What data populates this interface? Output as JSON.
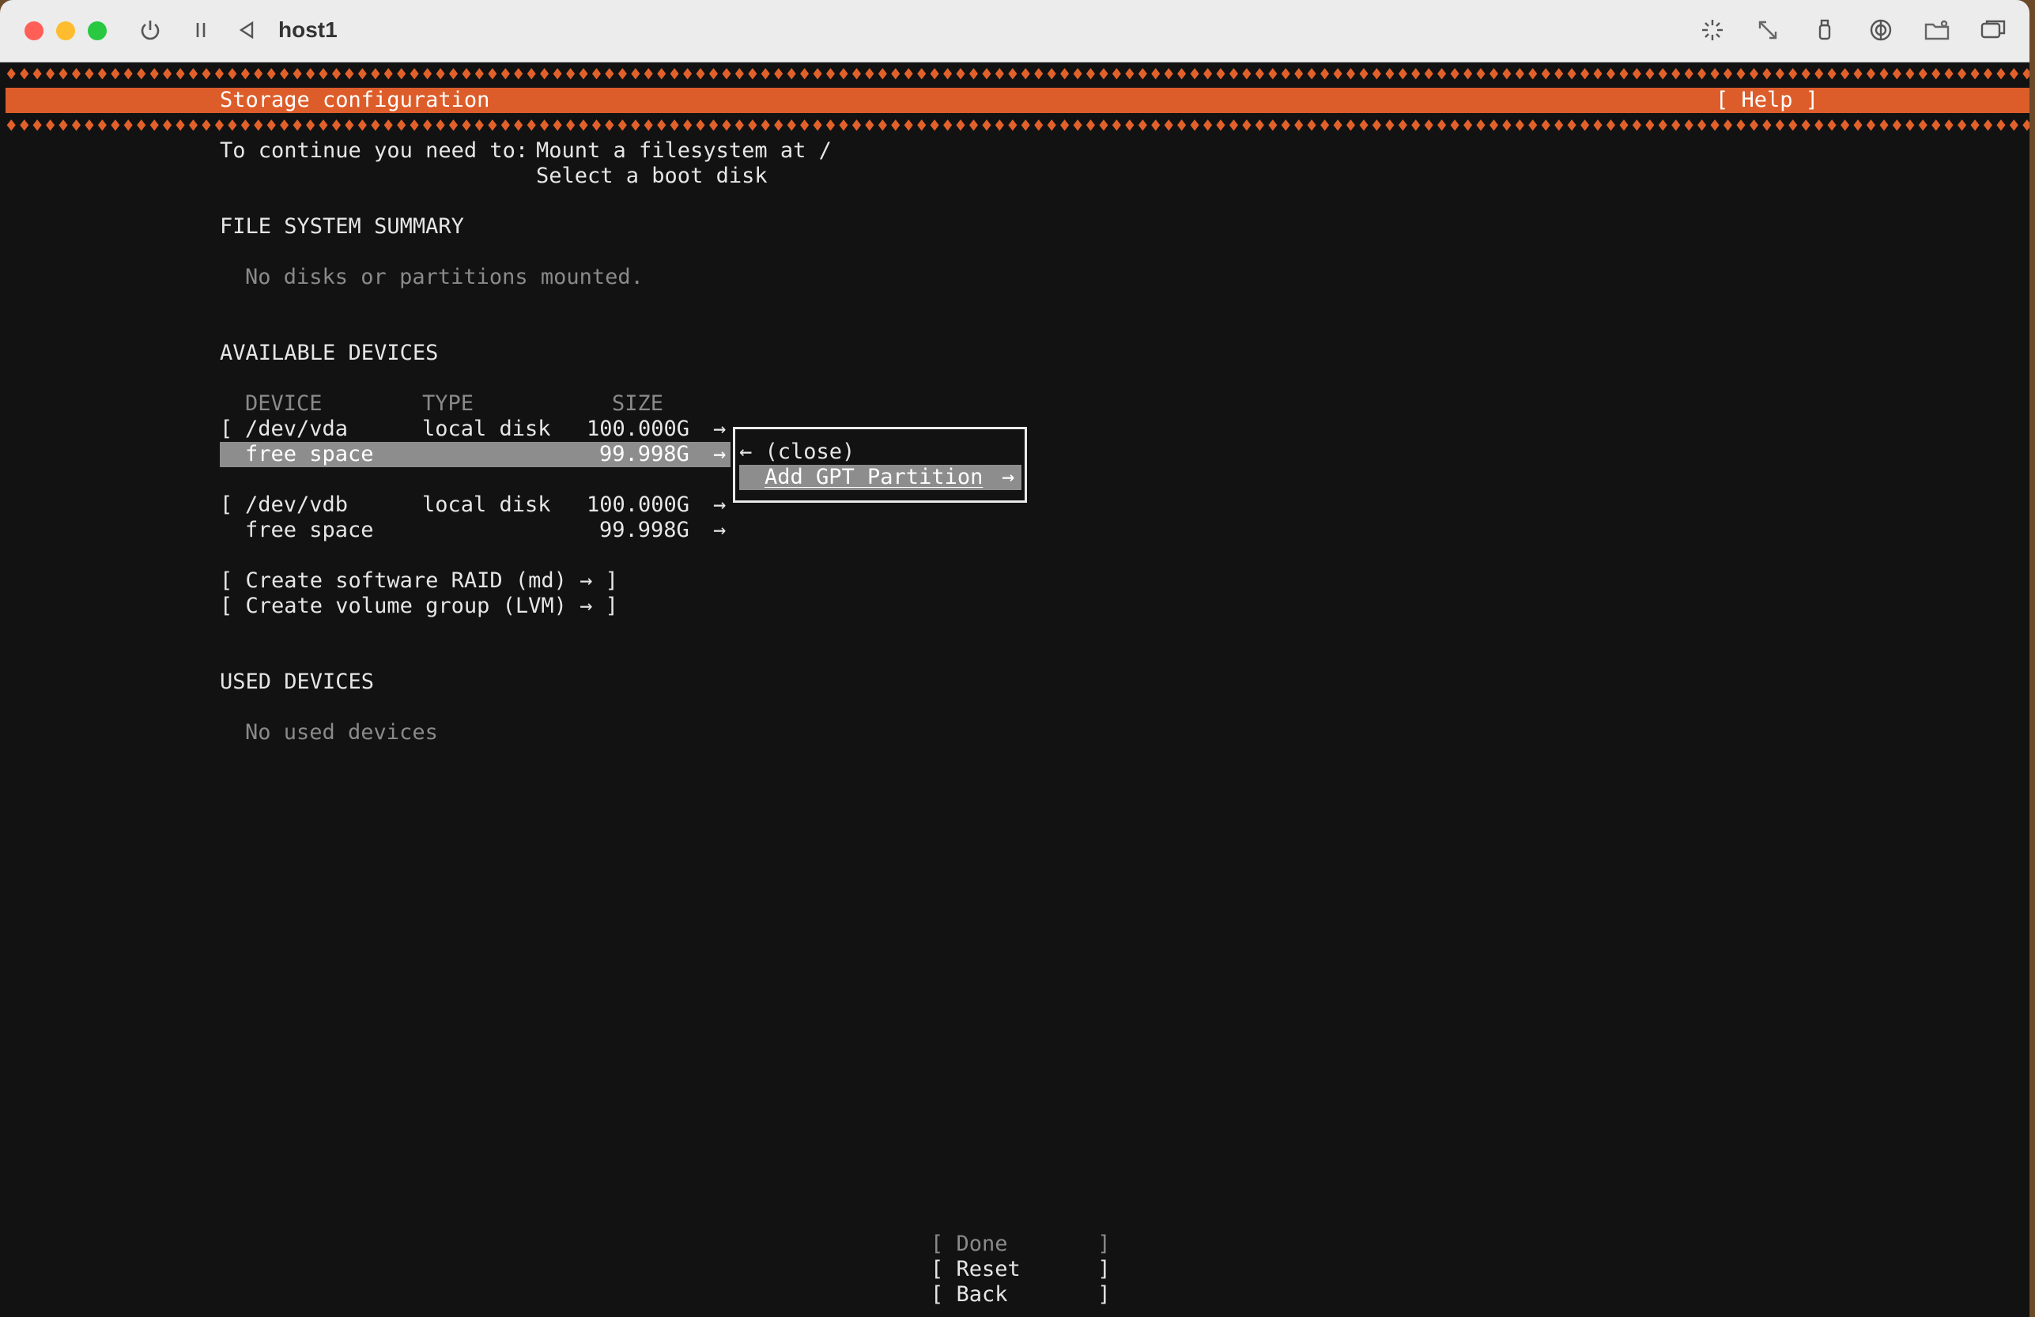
{
  "window": {
    "title": "host1",
    "colors": {
      "red_light": "#ff5f57",
      "yellow_light": "#febc2e",
      "green_light": "#28c840"
    },
    "toolbar_icons": [
      "power-icon",
      "pause-icon",
      "back-icon",
      "display-icon",
      "resize-icon",
      "usb-icon",
      "network-icon",
      "shared-folder-icon",
      "window-icon"
    ]
  },
  "installer": {
    "accent_color": "#dd5d2a",
    "band_pattern": "♦♦♦♦♦♦♦♦♦♦♦♦♦♦♦♦♦♦♦♦♦♦♦♦♦♦♦♦♦♦♦♦♦♦♦♦♦♦♦♦♦♦♦♦♦♦♦♦♦♦♦♦♦♦♦♦♦♦♦♦♦♦♦♦♦♦♦♦♦♦♦♦♦♦♦♦♦♦♦♦♦♦♦♦♦♦♦♦♦♦♦♦♦♦♦♦♦♦♦♦♦♦♦♦♦♦♦♦♦♦♦♦♦♦♦♦♦♦♦♦♦♦♦♦♦♦♦♦♦♦♦♦♦♦♦♦♦♦♦♦♦♦♦♦♦♦♦♦♦♦♦♦♦♦♦♦♦♦♦♦♦♦♦♦♦♦♦♦♦♦♦♦",
    "header": {
      "title": "Storage configuration",
      "help": "[ Help ]"
    },
    "instructions": {
      "prefix": "To continue you need to: ",
      "line1": "Mount a filesystem at /",
      "line2": "Select a boot disk"
    },
    "fs_summary": {
      "heading": "FILE SYSTEM SUMMARY",
      "empty": "No disks or partitions mounted."
    },
    "available": {
      "heading": "AVAILABLE DEVICES",
      "columns": {
        "device": "DEVICE",
        "type": "TYPE",
        "size": "SIZE"
      },
      "disks": [
        {
          "bracket": "[",
          "name": "/dev/vda",
          "type": "local disk",
          "size": "100.000G",
          "arrow": "→",
          "free_label": "free space",
          "free_size": "99.998G",
          "free_arrow": "→"
        },
        {
          "bracket": "[",
          "name": "/dev/vdb",
          "type": "local disk",
          "size": "100.000G",
          "arrow": "→",
          "free_label": "free space",
          "free_size": "99.998G",
          "free_arrow": "→"
        }
      ],
      "raid": "[ Create software RAID (md) → ]",
      "lvm": "[ Create volume group (LVM) → ]"
    },
    "context_menu": {
      "close": "← (close)",
      "add_gpt": "Add GPT Partition",
      "add_gpt_arrow": "→"
    },
    "used": {
      "heading": "USED DEVICES",
      "empty": "No used devices"
    },
    "buttons": {
      "done": "[ Done       ]",
      "reset": "[ Reset      ]",
      "back": "[ Back       ]"
    }
  }
}
